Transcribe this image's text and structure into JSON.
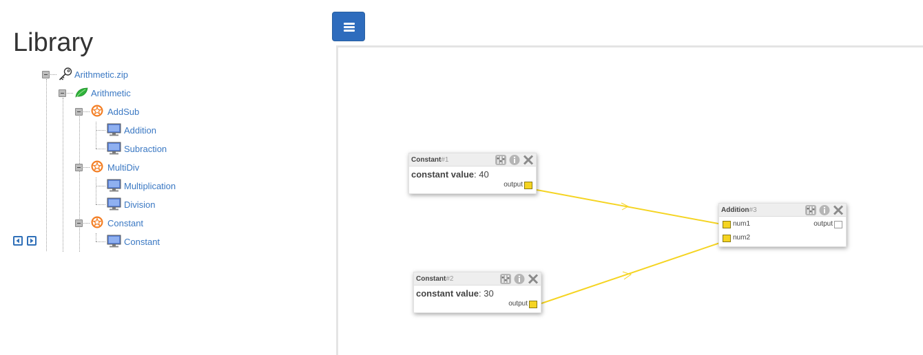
{
  "sidebar": {
    "title": "Library",
    "tree": {
      "root": {
        "label": "Arithmetic.zip",
        "icon": "key-icon"
      },
      "package": {
        "label": "Arithmetic",
        "icon": "leaf-icon"
      },
      "groups": [
        {
          "label": "AddSub",
          "icon": "star-badge-icon",
          "items": [
            "Addition",
            "Subraction"
          ]
        },
        {
          "label": "MultiDiv",
          "icon": "star-badge-icon",
          "items": [
            "Multiplication",
            "Division"
          ]
        },
        {
          "label": "Constant",
          "icon": "star-badge-icon",
          "items": [
            "Constant"
          ]
        }
      ]
    },
    "pager": {
      "prev_icon": "arrow-left-icon",
      "next_icon": "arrow-right-icon"
    }
  },
  "toolbar": {
    "menu_icon": "hamburger-menu-icon"
  },
  "modules": {
    "constant1": {
      "name": "Constant",
      "id": "#1",
      "field_label": "constant value",
      "field_sep": ": ",
      "field_value": "40",
      "output_label": "output"
    },
    "constant2": {
      "name": "Constant",
      "id": "#2",
      "field_label": "constant value",
      "field_sep": ": ",
      "field_value": "30",
      "output_label": "output"
    },
    "addition": {
      "name": "Addition",
      "id": "#3",
      "input1": "num1",
      "input2": "num2",
      "output_label": "output"
    }
  },
  "colors": {
    "accent": "#2e6cbd",
    "link": "#3a78c3",
    "wire": "#f5d422",
    "port": "#f5d422"
  }
}
